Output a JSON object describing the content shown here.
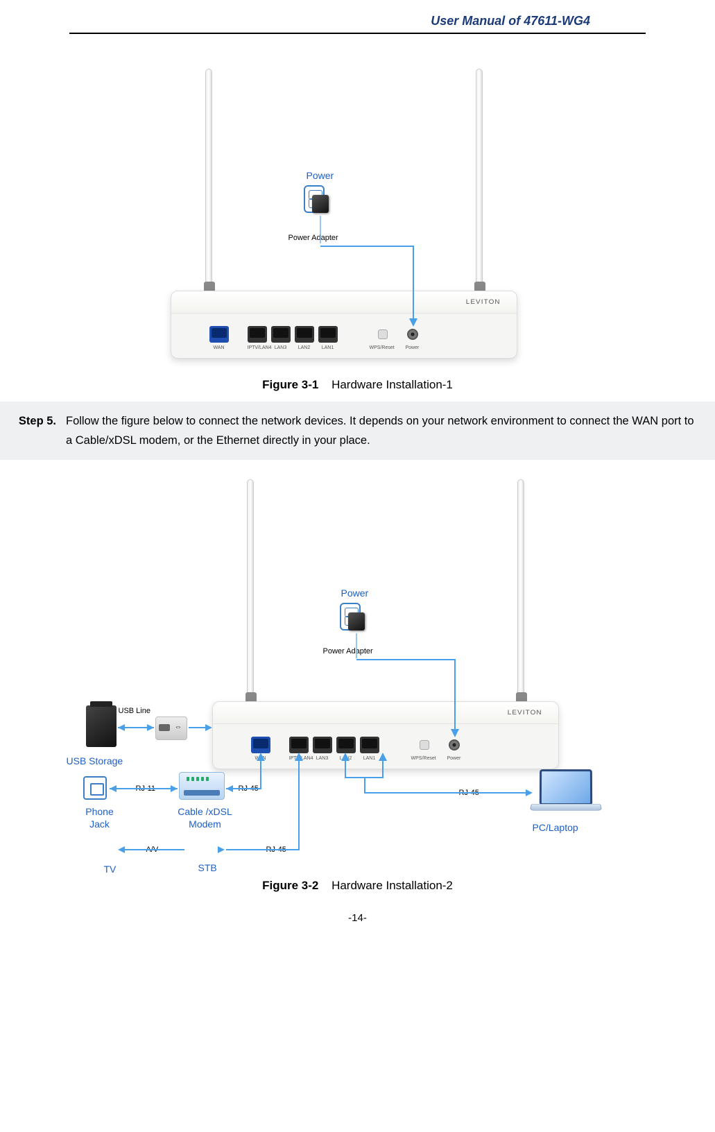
{
  "header": {
    "title": "User Manual of 47611-WG4"
  },
  "figure1": {
    "power_label": "Power",
    "adapter_label": "Power Adapter",
    "ports": [
      "WAN",
      "IPTV/LAN4",
      "LAN3",
      "LAN2",
      "LAN1"
    ],
    "wps_label": "WPS/Reset",
    "pwr_label": "Power",
    "brand": "LEVITON",
    "caption_num": "Figure 3-1",
    "caption_text": "Hardware Installation-1"
  },
  "step5": {
    "label": "Step 5.",
    "text": "Follow the figure below to connect the network devices. It depends on your network environment to connect the WAN port to a Cable/xDSL modem, or the Ethernet directly in your place."
  },
  "figure2": {
    "power_label": "Power",
    "adapter_label": "Power Adapter",
    "usb_line": "USB Line",
    "usb_storage": "USB Storage",
    "rj11": "RJ-11",
    "rj45": "RJ-45",
    "av": "A/V",
    "phone_jack": "Phone Jack",
    "modem": "Cable /xDSL Modem",
    "pc": "PC/Laptop",
    "tv": "TV",
    "stb": "STB",
    "ports": [
      "WAN",
      "IPTV/LAN4",
      "LAN3",
      "LAN2",
      "LAN1"
    ],
    "wps_label": "WPS/Reset",
    "pwr_label": "Power",
    "brand": "LEVITON",
    "caption_num": "Figure 3-2",
    "caption_text": "Hardware Installation-2"
  },
  "page_number": "-14-"
}
